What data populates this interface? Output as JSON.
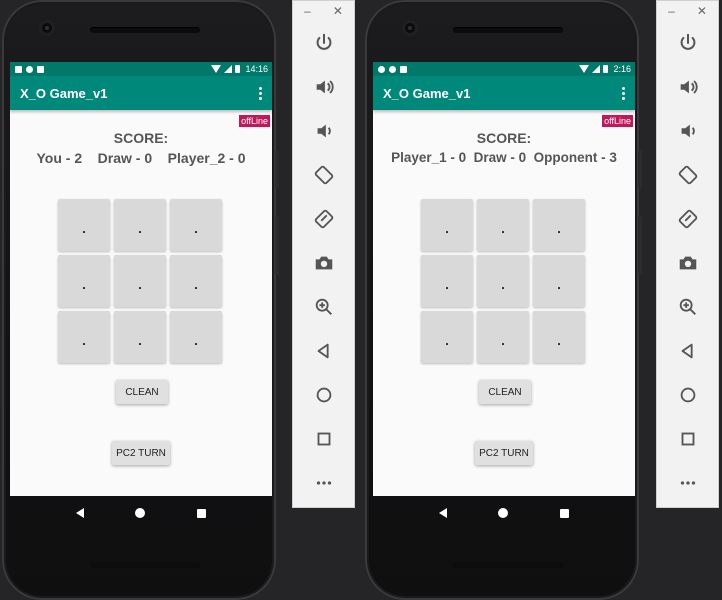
{
  "devices": [
    {
      "status_bar": {
        "time": "14:16"
      },
      "app_title": "X_O Game_v1",
      "offline_label": "offLine",
      "score_title": "SCORE:",
      "score_line": "You - 2    Draw - 0    Player_2 - 0",
      "board": [
        ".",
        ".",
        ".",
        ".",
        ".",
        ".",
        ".",
        ".",
        "."
      ],
      "clean_label": "CLEAN",
      "turn_label": "PC2 TURN"
    },
    {
      "status_bar": {
        "time": "2:16"
      },
      "app_title": "X_O Game_v1",
      "offline_label": "offLine",
      "score_title": "SCORE:",
      "score_line": "Player_1 - 0  Draw - 0  Opponent - 3",
      "board": [
        ".",
        ".",
        ".",
        ".",
        ".",
        ".",
        ".",
        ".",
        "."
      ],
      "clean_label": "CLEAN",
      "turn_label": "PC2 TURN"
    }
  ],
  "emulator_panel": {
    "minimize": "–",
    "close": "✕",
    "tools": [
      "power-icon",
      "volume-up-icon",
      "volume-down-icon",
      "rotate-left-icon",
      "rotate-right-icon",
      "camera-icon",
      "zoom-icon",
      "back-icon",
      "home-icon",
      "overview-icon",
      "more-icon"
    ]
  },
  "colors": {
    "status_bar": "#00796b",
    "toolbar": "#00897b",
    "offline_badge": "#c2185b",
    "screen_bg": "#fafafa",
    "cell_bg": "#d9d9d9"
  }
}
